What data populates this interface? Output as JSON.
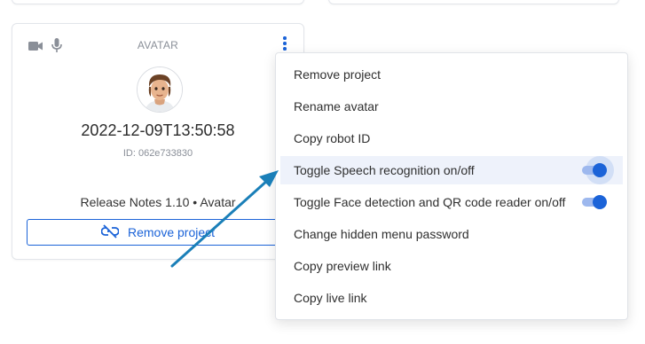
{
  "card": {
    "type_label": "AVATAR",
    "title": "2022-12-09T13:50:58",
    "id_text": "ID: 062e733830",
    "release": "Release Notes 1.10 • Avatar",
    "remove_button": "Remove project",
    "icons": [
      "video-camera-icon",
      "microphone-icon",
      "more-vert-icon",
      "link-off-icon"
    ]
  },
  "menu": {
    "items": [
      {
        "label": "Remove project"
      },
      {
        "label": "Rename avatar"
      },
      {
        "label": "Copy robot ID"
      },
      {
        "label": "Toggle Speech recognition on/off",
        "toggle": true,
        "on": true,
        "highlighted": true
      },
      {
        "label": "Toggle Face detection and QR code reader on/off",
        "toggle": true,
        "on": true
      },
      {
        "label": "Change hidden menu password"
      },
      {
        "label": "Copy preview link"
      },
      {
        "label": "Copy live link"
      }
    ]
  },
  "colors": {
    "accent": "#1b63d8",
    "arrow": "#1a7fb8",
    "highlight_bg": "#eef2fb"
  }
}
